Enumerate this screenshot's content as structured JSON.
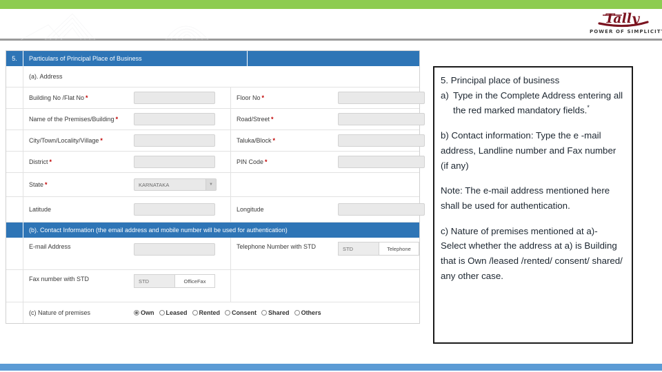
{
  "slide": {
    "accent_green": "#8DCC51",
    "accent_blue": "#5B9BD5",
    "header_blue": "#2E75B6",
    "mandatory_color": "#C00000"
  },
  "logo": {
    "brand": "Tally",
    "tagline": "POWER OF SIMPLICITY"
  },
  "form": {
    "section_number": "5.",
    "section_title": "Particulars of Principal Place of Business",
    "subsection_a": "(a). Address",
    "address_rows": [
      {
        "left_label": "Building No /Flat No",
        "left_mandatory": "*",
        "left_field": "input",
        "right_label": "Floor No",
        "right_mandatory": "*",
        "right_field": "input"
      },
      {
        "left_label": "Name of the Premises/Building",
        "left_mandatory": "*",
        "left_field": "input",
        "right_label": "Road/Street",
        "right_mandatory": "*",
        "right_field": "input"
      },
      {
        "left_label": "City/Town/Locality/Village",
        "left_mandatory": "*",
        "left_field": "input",
        "right_label": "Taluka/Block",
        "right_mandatory": "*",
        "right_field": "input"
      },
      {
        "left_label": "District",
        "left_mandatory": "*",
        "left_field": "input",
        "right_label": "PIN Code",
        "right_mandatory": "*",
        "right_field": "input"
      }
    ],
    "state_row": {
      "label": "State",
      "mandatory": "*",
      "selected_value": "KARNATAKA",
      "chevron": "chevron-down-icon"
    },
    "geo_row": {
      "left_label": "Latitude",
      "right_label": "Longitude"
    },
    "subsection_b": "(b). Contact Information (the email address and mobile number will be used for authentication)",
    "contact_rows": [
      {
        "left_label": "E-mail Address",
        "left_field": "input",
        "right_label": "Telephone Number with STD",
        "right_field": "split",
        "right_part1": "STD",
        "right_part2": "Telephone"
      },
      {
        "left_label": "Fax number with STD",
        "left_field": "split",
        "left_part1": "STD",
        "left_part2": "OfficeFax",
        "right_label": "",
        "right_field": "none"
      }
    ],
    "subsection_c": {
      "label": "(c)  Nature of premises",
      "options": [
        {
          "label": "Own",
          "selected": true
        },
        {
          "label": "Leased",
          "selected": false
        },
        {
          "label": "Rented",
          "selected": false
        },
        {
          "label": "Consent",
          "selected": false
        },
        {
          "label": "Shared",
          "selected": false
        },
        {
          "label": "Others",
          "selected": false
        }
      ]
    }
  },
  "notes": {
    "line_title": "5. Principal place of business",
    "a_marker": "a)",
    "a_text": "Type in the Complete Address entering all the red marked mandatory fields.",
    "a_star": "*",
    "b_text": "b) Contact information: Type the e -mail address, Landline number and Fax number (if any)",
    "note_text": "Note: The e-mail address mentioned here shall be used for authentication.",
    "c_text": "c) Nature of premises mentioned at a)- Select whether the address at a) is Building that is  Own /leased /rented/ consent/ shared/ any other case."
  }
}
